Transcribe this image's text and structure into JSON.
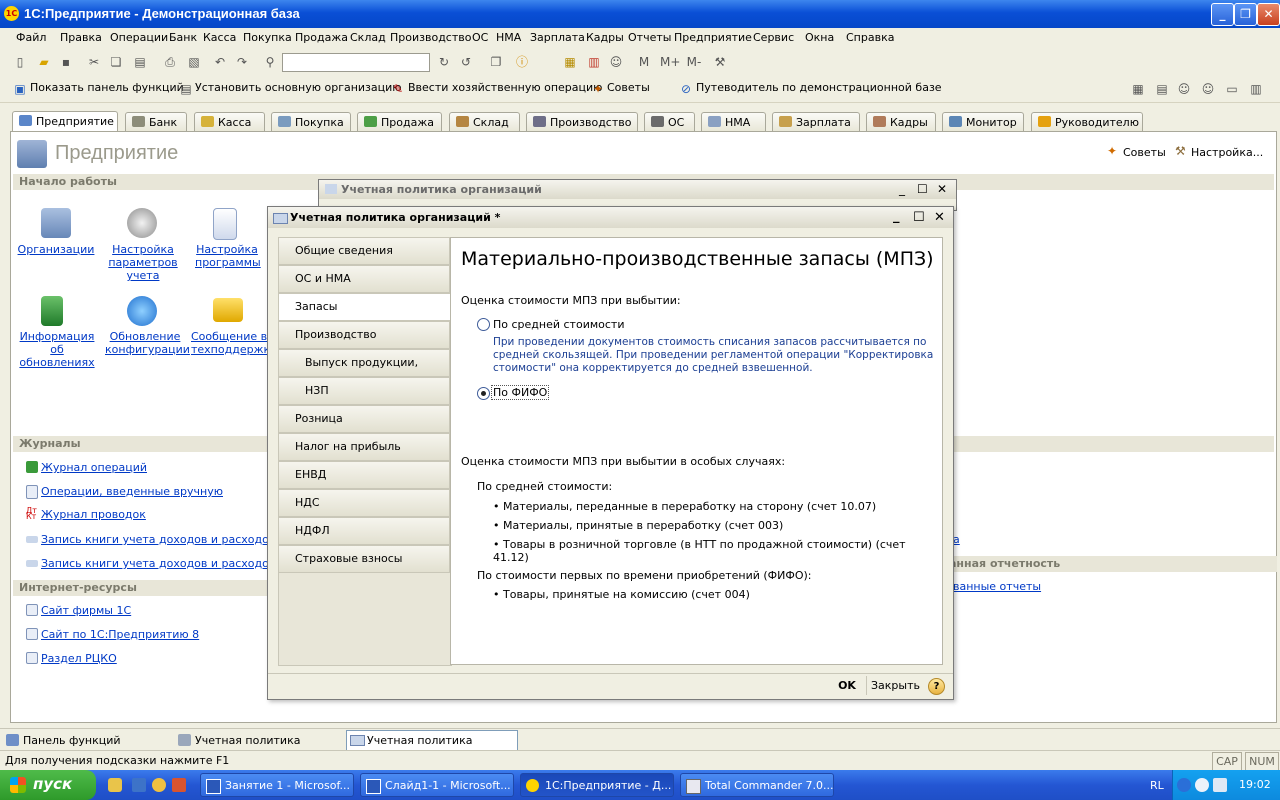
{
  "window": {
    "title": "1С:Предприятие - Демонстрационная база",
    "logo_text": "1С"
  },
  "menu": [
    "Файл",
    "Правка",
    "Операции",
    "Банк",
    "Касса",
    "Покупка",
    "Продажа",
    "Склад",
    "Производство",
    "ОС",
    "НМА",
    "Зарплата",
    "Кадры",
    "Отчеты",
    "Предприятие",
    "Сервис",
    "Окна",
    "Справка"
  ],
  "toolbar2": {
    "show_panel": "Показать панель функций",
    "set_org": "Установить основную организацию",
    "enter_op": "Ввести хозяйственную операцию",
    "tips": "Советы",
    "guide": "Путеводитель по демонстрационной базе"
  },
  "tabs": [
    "Предприятие",
    "Банк",
    "Касса",
    "Покупка",
    "Продажа",
    "Склад",
    "Производство",
    "ОС",
    "НМА",
    "Зарплата",
    "Кадры",
    "Монитор",
    "Руководителю"
  ],
  "panel": {
    "title": "Предприятие",
    "tips": "Советы",
    "settings": "Настройка...",
    "start_section": "Начало работы",
    "big_links": [
      {
        "label": "Организации",
        "icon": "buildings-icon"
      },
      {
        "label": "Настройка параметров учета",
        "icon": "gear-icon"
      },
      {
        "label": "Настройка программы",
        "icon": "checklist-icon"
      },
      {
        "label": "Информация об обновлениях",
        "icon": "www-icon"
      },
      {
        "label": "Обновление конфигурации",
        "icon": "globe-icon"
      },
      {
        "label": "Сообщение в техподдержку",
        "icon": "mail-icon"
      }
    ],
    "journals_section": "Журналы",
    "journals": [
      "Журнал операций",
      "Операции, введенные вручную",
      "Журнал проводок",
      "Запись книги учета доходов и расходов (УС",
      "Запись книги учета доходов и расходов (ИП"
    ],
    "internet_section": "Интернет-ресурсы",
    "internet": [
      "Сайт фирмы 1С",
      "Сайт по 1С:Предприятию 8",
      "Раздел РЦКО"
    ],
    "right_fragment_link1": "а",
    "right_fragment_section": "анная отчетность",
    "right_fragment_link2": "ванные отчеты"
  },
  "bg_dialog": {
    "title": "Учетная политика организаций"
  },
  "dialog": {
    "title": "Учетная политика организаций *",
    "nav": [
      "Общие сведения",
      "ОС и НМА",
      "Запасы",
      "Производство",
      "Выпуск продукции, услуг",
      "НЗП",
      "Розница",
      "Налог на прибыль",
      "ЕНВД",
      "НДС",
      "НДФЛ",
      "Страховые взносы"
    ],
    "selected_nav": "Запасы",
    "heading": "Материально-производственные запасы (МПЗ)",
    "q1": "Оценка стоимости МПЗ при выбытии:",
    "opt_avg": "По средней стоимости",
    "opt_avg_desc": [
      "При проведении документов стоимость списания запасов рассчитывается по",
      "средней скользящей. При проведении регламентой операции \"Корректировка",
      "стоимости\" она корректируется до средней взвешенной."
    ],
    "opt_fifo": "По ФИФО",
    "selected_option": "По ФИФО",
    "q2": "Оценка стоимости МПЗ при выбытии в  особых случаях:",
    "avg_title": "По средней стоимости:",
    "avg_items": [
      "Материалы, переданные в переработку на сторону (счет 10.07)",
      "Материалы, принятые в переработку (счет 003)",
      "Товары в розничной торговле (в НТТ по продажной стоимости) (счет 41.12)"
    ],
    "fifo_title": "По стоимости первых по времени приобретений (ФИФО):",
    "fifo_items": [
      "Товары, принятые на комиссию (счет 004)"
    ],
    "ok": "OK",
    "close": "Закрыть",
    "help": "?"
  },
  "task_panel": [
    "Панель функций",
    "Учетная политика организ...",
    "Учетная политика организ..."
  ],
  "status": {
    "hint": "Для получения подсказки нажмите F1",
    "cap": "CAP",
    "num": "NUM"
  },
  "taskbar": {
    "start": "пуск",
    "tasks": [
      "Занятие 1 - Microsof...",
      "Слайд1-1 - Microsoft...",
      "1С:Предприятие - Д...",
      "Total Commander 7.0..."
    ],
    "lang": "RL",
    "clock": "19:02"
  },
  "colors": {
    "xp_blue": "#0a4fd6",
    "link": "#0039c6",
    "start_green": "#3aa836"
  }
}
